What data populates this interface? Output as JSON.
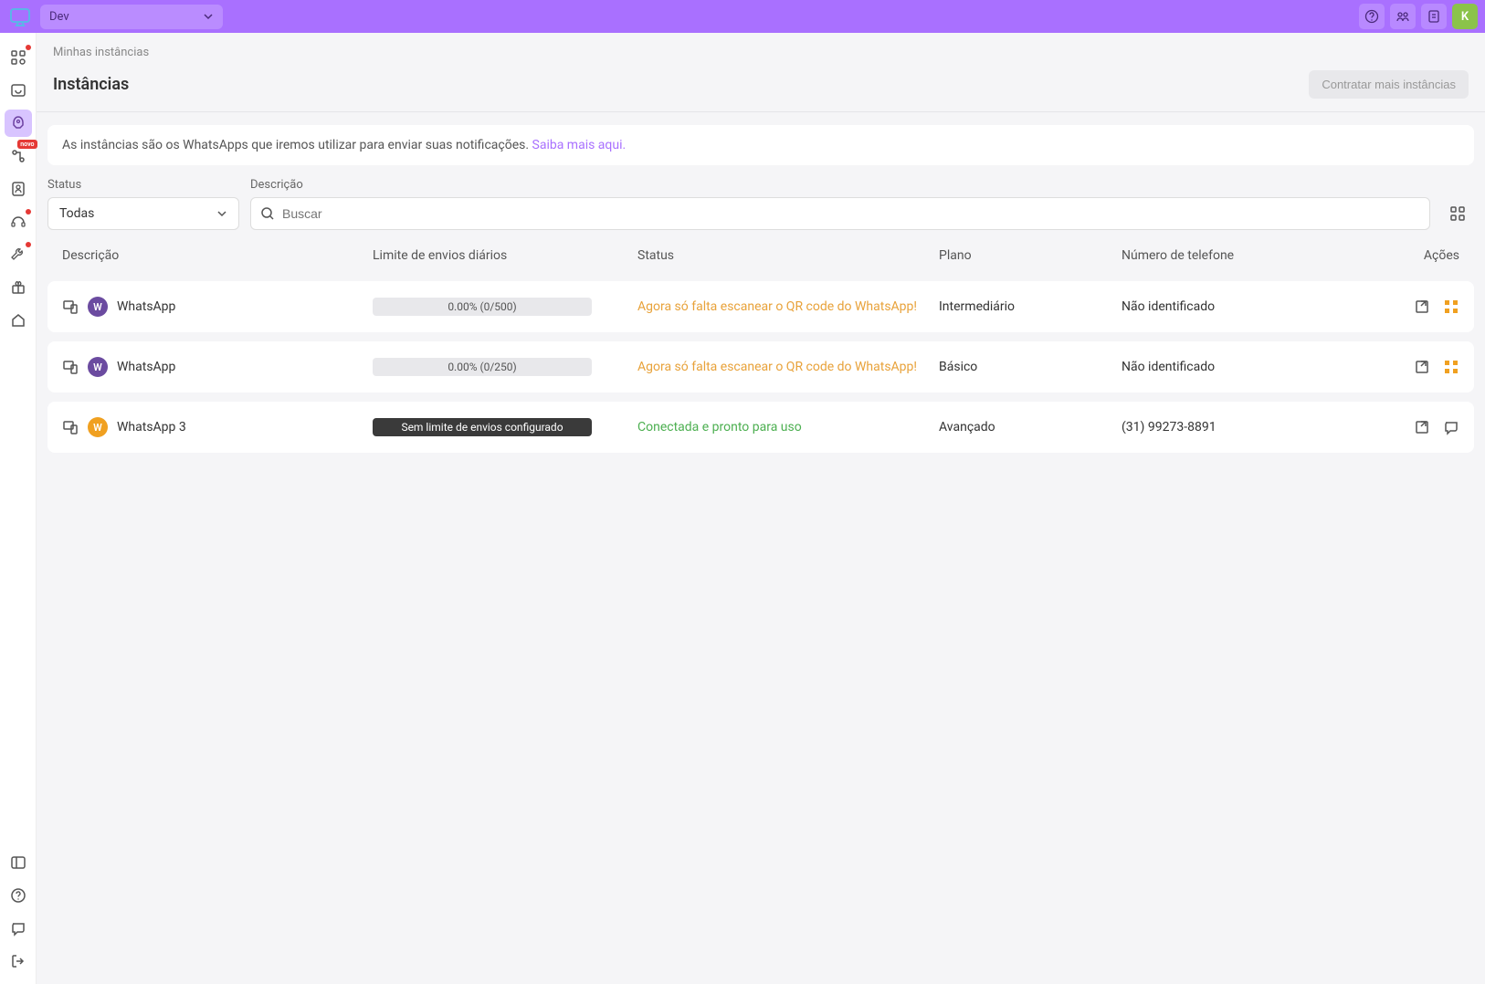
{
  "workspace": {
    "name": "Dev"
  },
  "user": {
    "initial": "K"
  },
  "sidebar": {
    "badge_novo": "novo"
  },
  "breadcrumb": "Minhas instâncias",
  "page": {
    "title": "Instâncias",
    "hire_button": "Contratar mais instâncias"
  },
  "banner": {
    "text": "As instâncias são os WhatsApps que iremos utilizar para enviar suas notificações. ",
    "link": "Saiba mais aqui."
  },
  "filters": {
    "status_label": "Status",
    "status_value": "Todas",
    "desc_label": "Descrição",
    "search_placeholder": "Buscar"
  },
  "columns": {
    "desc": "Descrição",
    "limit": "Limite de envios diários",
    "status": "Status",
    "plan": "Plano",
    "phone": "Número de telefone",
    "actions": "Ações"
  },
  "rows": [
    {
      "name": "WhatsApp",
      "avatar_color": "purple",
      "limit_text": "0.00% (0/500)",
      "limit_dark": false,
      "status_text": "Agora só falta escanear o QR code do WhatsApp!",
      "status_class": "warn",
      "plan": "Intermediário",
      "phone": "Não identificado",
      "action2_type": "qr"
    },
    {
      "name": "WhatsApp",
      "avatar_color": "purple",
      "limit_text": "0.00% (0/250)",
      "limit_dark": false,
      "status_text": "Agora só falta escanear o QR code do WhatsApp!",
      "status_class": "warn",
      "plan": "Básico",
      "phone": "Não identificado",
      "action2_type": "qr"
    },
    {
      "name": "WhatsApp 3",
      "avatar_color": "orange",
      "limit_text": "Sem limite de envios configurado",
      "limit_dark": true,
      "status_text": "Conectada e pronto para uso",
      "status_class": "ok",
      "plan": "Avançado",
      "phone": "(31) 99273-8891",
      "action2_type": "chat"
    }
  ]
}
